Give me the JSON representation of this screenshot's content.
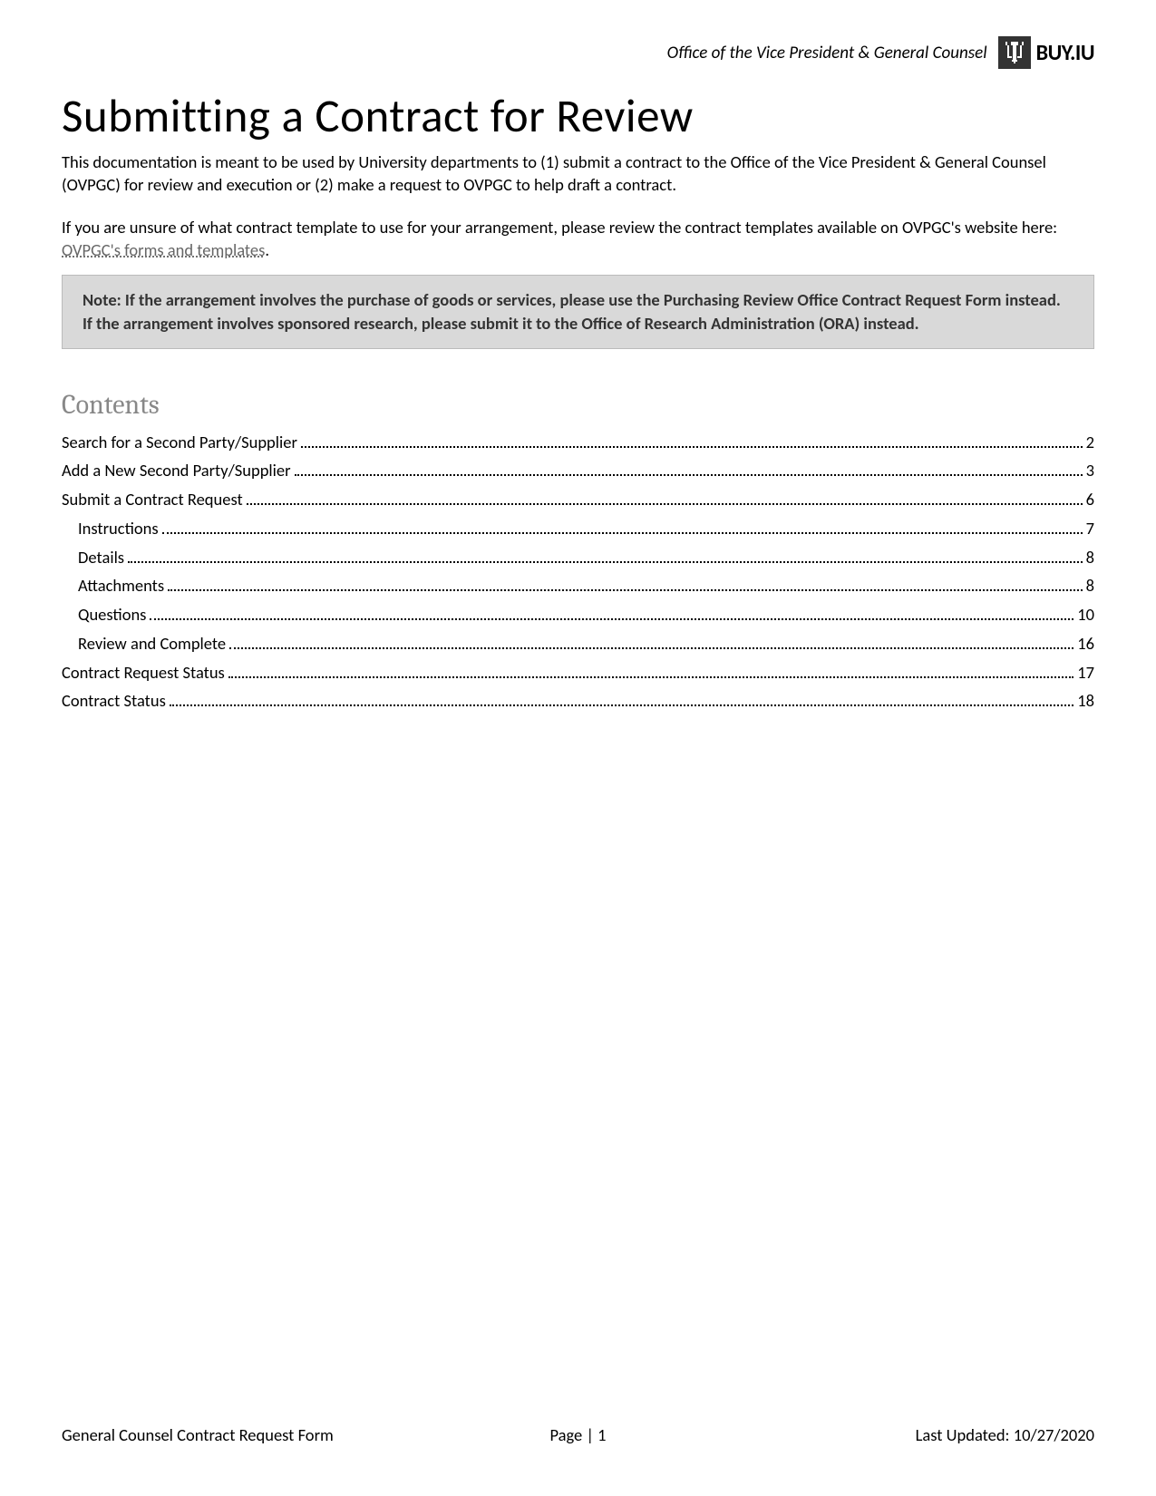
{
  "header": {
    "office": "Office of the Vice President & General Counsel",
    "brand": "BUY.IU"
  },
  "title": "Submitting a Contract for Review",
  "intro1": "This documentation is meant to be used by University departments to (1) submit a contract to the Office of the Vice President & General Counsel (OVPGC) for review and execution or (2) make a request to OVPGC to help draft a contract.",
  "intro2_pre": "If you are unsure of what contract template to use for your arrangement, please review the contract templates available on OVPGC's website here: ",
  "intro2_link": "OVPGC's forms and templates",
  "intro2_post": ".",
  "note": "Note: If the arrangement involves the purchase of goods or services, please use the Purchasing Review Office Contract Request Form instead. If the arrangement involves sponsored research, please submit it to the Office of Research Administration (ORA) instead.",
  "contents_title": "Contents",
  "toc": [
    {
      "label": "Search for a Second Party/Supplier",
      "page": "2",
      "indent": false
    },
    {
      "label": "Add a New Second Party/Supplier",
      "page": "3",
      "indent": false
    },
    {
      "label": "Submit a Contract Request",
      "page": "6",
      "indent": false
    },
    {
      "label": "Instructions",
      "page": "7",
      "indent": true
    },
    {
      "label": "Details",
      "page": "8",
      "indent": true
    },
    {
      "label": "Attachments",
      "page": "8",
      "indent": true
    },
    {
      "label": "Questions",
      "page": "10",
      "indent": true
    },
    {
      "label": "Review and Complete",
      "page": "16",
      "indent": true
    },
    {
      "label": "Contract Request Status",
      "page": "17",
      "indent": false
    },
    {
      "label": "Contract Status",
      "page": "18",
      "indent": false
    }
  ],
  "footer": {
    "left": "General Counsel Contract Request Form",
    "center": "Page | 1",
    "right": "Last Updated: 10/27/2020"
  }
}
